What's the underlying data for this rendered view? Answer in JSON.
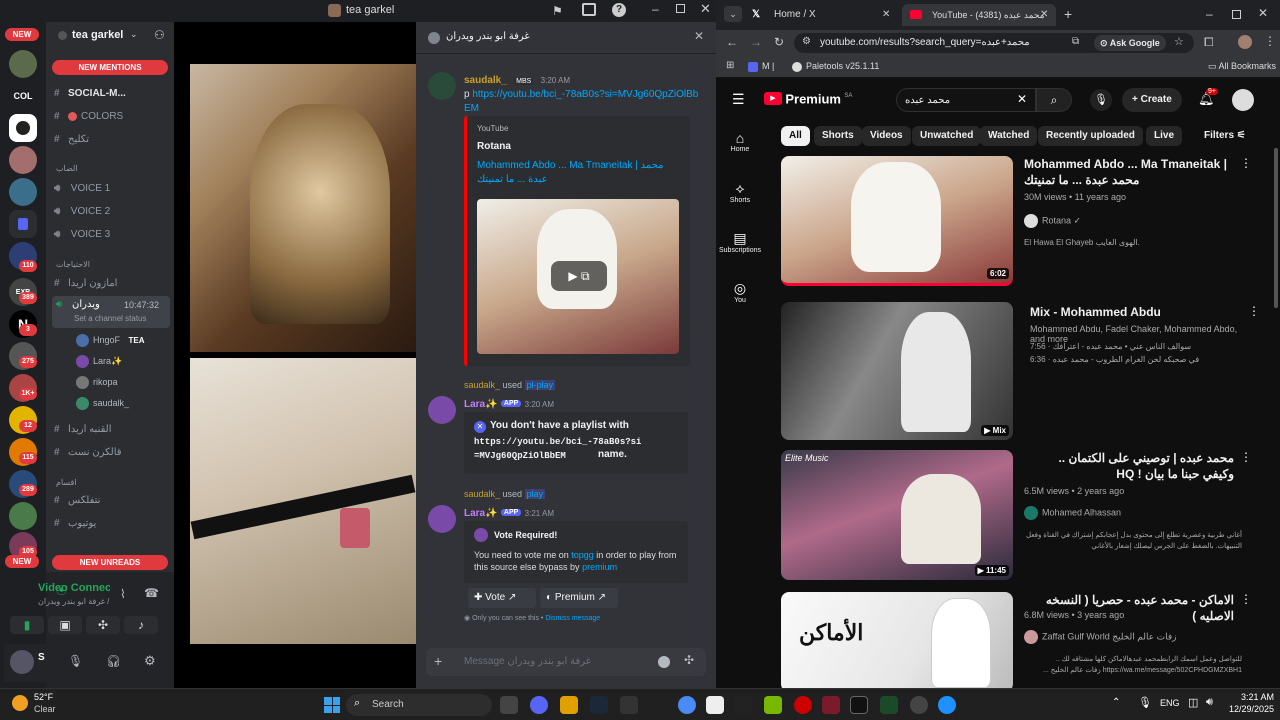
{
  "discord": {
    "window_title": "tea garkel",
    "server_name": "tea garkel",
    "new_mentions": "NEW MENTIONS",
    "new_unreads": "NEW UNREADS",
    "new_top": "NEW",
    "new_bottom": "NEW",
    "channels": [
      {
        "name": "SOCIAL-M..."
      },
      {
        "name": "COLORS"
      },
      {
        "name": "تكليح"
      }
    ],
    "cat_voice": "الصاب",
    "voice_channels": [
      "VOICE 1",
      "VOICE 2",
      "VOICE 3"
    ],
    "cat_needs": "الاحتياجات",
    "needs_channels": [
      "امازون اريدا"
    ],
    "active_channel": "ويدران",
    "active_time": "10:47:32",
    "active_status": "Set a channel status",
    "voice_users": [
      "HngoF",
      "Lara✨",
      "rikopa",
      "saudalk_"
    ],
    "voice_user_tag": "TEA",
    "extra_channels": [
      "القنبه اريدا",
      "قالكرن نست"
    ],
    "cat_other": "اقسام",
    "other_channels": [
      "نتفلكس",
      "يوتيوب"
    ],
    "server_badges": [
      "110",
      "389",
      "3",
      "275",
      "1K+",
      "12",
      "115",
      "289",
      "105"
    ],
    "srv_labels": [
      "COL"
    ],
    "voice_connected": "Video Connected",
    "voice_location": "غرفة ابو بندر ويدران / ",
    "user_name": "S"
  },
  "chat": {
    "header": "غرفة ابو بندر ويدران",
    "msg1": {
      "user": "saudalk_",
      "badge": "MBS",
      "time": "3:20 AM",
      "prefix": "p ",
      "link": "https://youtu.be/bci_-78aB0s?si=MVJg60QpZiOlBbEM",
      "embed_provider": "YouTube",
      "embed_author": "Rotana",
      "embed_title": "Mohammed Abdo ... Ma Tmaneitak | محمد عبدة ... ما تمنيتك"
    },
    "msg2": {
      "used_by": "saudalk_",
      "used_word": "used",
      "cmd": "pl-play",
      "user": "Lara✨",
      "app": "APP",
      "time": "3:20 AM",
      "error": "You don't have a playlist with",
      "error_code": "https://youtu.be/bci_-78aB0s?si=MVJg60QpZiOlBbEM",
      "error_tail": "name."
    },
    "msg3": {
      "used_by": "saudalk_",
      "used_word": "used",
      "cmd": "play",
      "user": "Lara✨",
      "app": "APP",
      "time": "3:21 AM",
      "title": "Vote Required!",
      "body1": "You need to vote me on ",
      "body_link1": "topgg",
      "body2": " in order to play from this source else bypass by ",
      "body_link2": "premium",
      "btn_vote": "Vote",
      "btn_premium": "Premium",
      "only_you": "Only you can see this • ",
      "dismiss": "Dismiss message"
    },
    "input_placeholder": "Message غرفة ابو بندر ويدران"
  },
  "browser": {
    "tabs": [
      {
        "title": "Home / X"
      },
      {
        "title": "YouTube - محمد عبده (4381)"
      }
    ],
    "url": "youtube.com/results?search_query=محمد+عبده",
    "ask_google": "Ask Google",
    "bookmark1": "M |",
    "bookmark2": "Paletools v25.1.11",
    "all_bookmarks": "All Bookmarks"
  },
  "youtube": {
    "logo": "Premium",
    "logo_region": "SA",
    "search_value": "محمد عبده",
    "create": "Create",
    "notif_count": "9+",
    "nav": [
      "Home",
      "Shorts",
      "Subscriptions",
      "You"
    ],
    "chips": [
      "All",
      "Shorts",
      "Videos",
      "Unwatched",
      "Watched",
      "Recently uploaded",
      "Live"
    ],
    "filters": "Filters",
    "videos": [
      {
        "title": "Mohammed Abdo ... Ma Tmaneitak | محمد عبدة ... ما تمنيتك",
        "meta": "30M views • 11 years ago",
        "channel": "Rotana",
        "desc": "El Hawa El Ghayeb الهوى الغايب.",
        "duration": "6:02"
      },
      {
        "title": "Mix - Mohammed Abdu",
        "meta": "Mohammed Abdu, Fadel Chaker, Mohammed Abdo, and more",
        "line1": "7:56 · سوالف الناس عني • محمد عبده - اعترافك",
        "line2": "6:36 · في صحبكه لحن الغرام الطروب - محمد عبده",
        "duration": "Mix"
      },
      {
        "title": "محمد عبده | توصيني على الكتمان .. وكيفي حبنا ما بيان ! HQ",
        "meta": "6.5M views • 2 years ago",
        "channel": "Mohamed Alhassan",
        "desc": "أغاني طربية وعصرية تطلع إلى محتوى بدل إعجابكم إشتراك في القناة وفعل التنبيهات. بالضغط على الجرس ليصلك إشعار بالأغاني",
        "duration": "11:45",
        "thumb_caption": "Elite Music"
      },
      {
        "title": "الاماكن - محمد عبده - حصريا ( النسخه الاصليه )",
        "meta": "6.8M views • 3 years ago",
        "channel": "Zaffat Gulf World زفات عالم الخليج",
        "desc": "للتواصل وعمل اسمك الرابطمحمد عبدهالاماكن كلها مشتاقه لك .. https://wa.me/message/502CPHDGMZXBH1 زفات عالم الخليج ...",
        "thumb_text": "الأماكن"
      }
    ]
  },
  "taskbar": {
    "temp": "52°F",
    "weather": "Clear",
    "search": "Search",
    "lang": "ENG",
    "time": "3:21 AM",
    "date": "12/29/2025"
  }
}
